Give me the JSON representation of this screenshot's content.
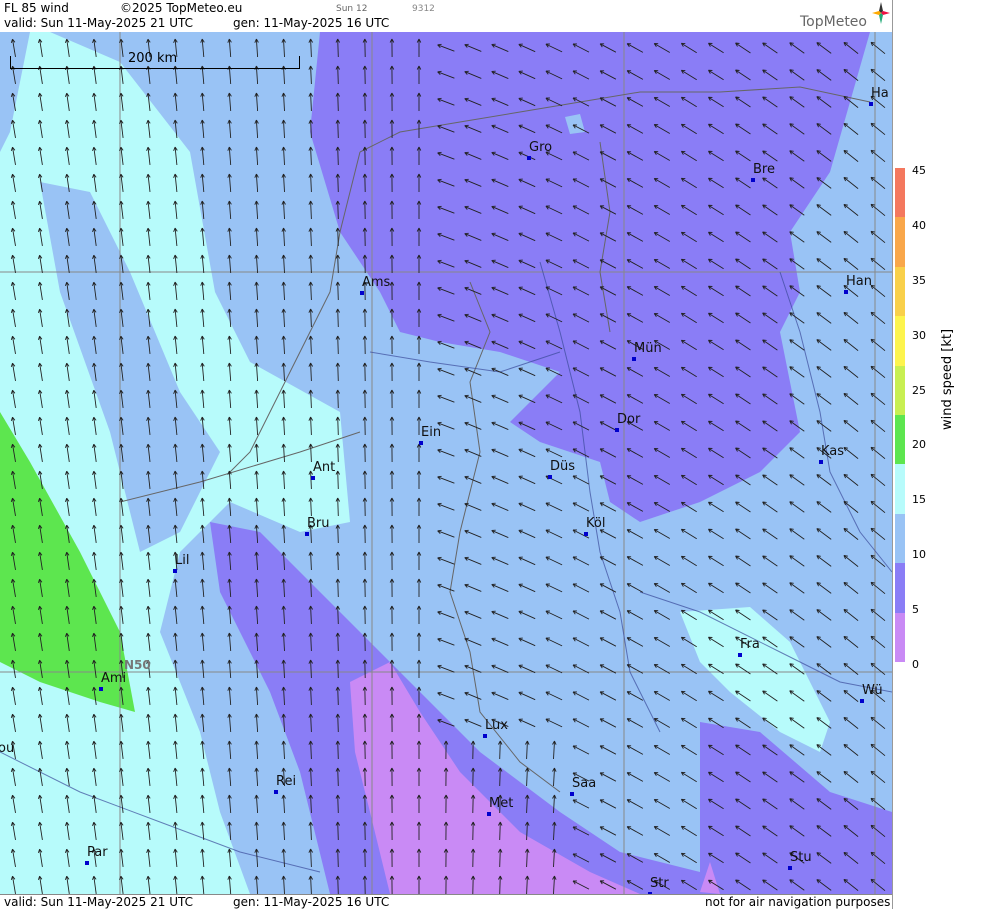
{
  "header": {
    "product": "FL 85 wind",
    "copyright": "©2025 TopMeteo.eu",
    "valid": "valid:  Sun  11-May-2025  21 UTC",
    "gen": "gen: 11-May-2025 16 UTC",
    "sun": "Sun 12",
    "code": "9312",
    "logo": "TopMeteo"
  },
  "footer": {
    "valid": "valid:  Sun  11-May-2025  21 UTC",
    "gen": "gen: 11-May-2025 16 UTC",
    "disclaimer": "not for air navigation purposes"
  },
  "scale_label": "200 km",
  "lat_label": "N50",
  "colorbar": {
    "label": "wind speed  [kt]",
    "ticks": [
      "45",
      "40",
      "35",
      "30",
      "25",
      "20",
      "15",
      "10",
      "5",
      "0"
    ],
    "colors": [
      "#f4785e",
      "#f9a74a",
      "#f9d04a",
      "#fdf44d",
      "#c8ef52",
      "#5de64f",
      "#b7fbfb",
      "#99c3f5",
      "#8a7df6",
      "#c98af5"
    ]
  },
  "cities": [
    {
      "name": "Gro"
    },
    {
      "name": "Bre"
    },
    {
      "name": "Ha"
    },
    {
      "name": "Ams"
    },
    {
      "name": "Han"
    },
    {
      "name": "Mün"
    },
    {
      "name": "Dor"
    },
    {
      "name": "Ein"
    },
    {
      "name": "Kas"
    },
    {
      "name": "Düs"
    },
    {
      "name": "Ant"
    },
    {
      "name": "Köl"
    },
    {
      "name": "Bru"
    },
    {
      "name": "Lil"
    },
    {
      "name": "Fra"
    },
    {
      "name": "Ami"
    },
    {
      "name": "Wü"
    },
    {
      "name": "Lux"
    },
    {
      "name": "ou"
    },
    {
      "name": "Rei"
    },
    {
      "name": "Saa"
    },
    {
      "name": "Met"
    },
    {
      "name": "Stu"
    },
    {
      "name": "Par"
    },
    {
      "name": "Str"
    }
  ]
}
